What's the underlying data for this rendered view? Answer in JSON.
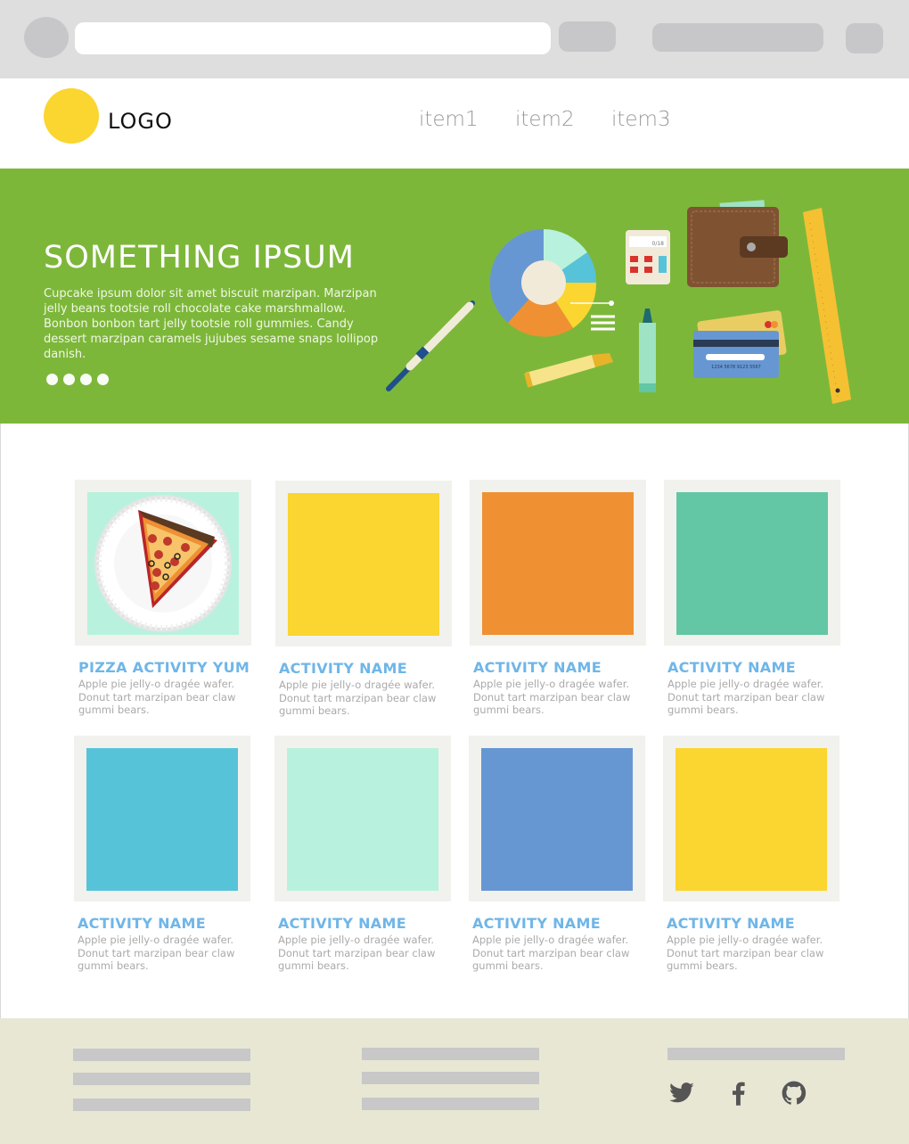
{
  "header": {
    "logo_text": "LOGO",
    "nav": [
      "item1",
      "item2",
      "item3"
    ],
    "logo_color": "#fbd530"
  },
  "hero": {
    "title": "SOMETHING IPSUM",
    "text": "Cupcake ipsum dolor sit amet biscuit marzipan. Marzipan jelly beans tootsie roll chocolate cake marshmallow. Bonbon bonbon tart jelly tootsie roll gummies. Candy dessert marzipan caramels jujubes sesame snaps lollipop danish.",
    "background": "#7db73a",
    "slide_count": 4,
    "calculator_display": "0/18",
    "card_number": "1234 5678 9123 5567"
  },
  "activities": [
    {
      "title": "PIZZA ACTIVITY YUM",
      "description": "Apple pie jelly-o dragée wafer. Donut tart marzipan bear claw gummi bears.",
      "color": "#b8f2de",
      "image": "pizza"
    },
    {
      "title": "ACTIVITY NAME",
      "description": "Apple pie jelly-o dragée wafer. Donut tart marzipan bear claw gummi bears.",
      "color": "#fbd530"
    },
    {
      "title": "ACTIVITY NAME",
      "description": "Apple pie jelly-o dragée wafer. Donut tart marzipan bear claw gummi bears.",
      "color": "#ef9132"
    },
    {
      "title": "ACTIVITY NAME",
      "description": "Apple pie jelly-o dragée wafer. Donut tart marzipan bear claw gummi bears.",
      "color": "#63c6a5"
    },
    {
      "title": "ACTIVITY NAME",
      "description": "Apple pie jelly-o dragée wafer. Donut tart marzipan bear claw gummi bears.",
      "color": "#57c3d8"
    },
    {
      "title": "ACTIVITY NAME",
      "description": "Apple pie jelly-o dragée wafer. Donut tart marzipan bear claw gummi bears.",
      "color": "#b8f2de"
    },
    {
      "title": "ACTIVITY NAME",
      "description": "Apple pie jelly-o dragée wafer. Donut tart marzipan bear claw gummi bears.",
      "color": "#6697d3"
    },
    {
      "title": "ACTIVITY NAME",
      "description": "Apple pie jelly-o dragée wafer. Donut tart marzipan bear claw gummi bears.",
      "color": "#fbd530"
    }
  ],
  "footer": {
    "social_icons": [
      "twitter-icon",
      "facebook-icon",
      "github-icon"
    ],
    "background": "#e8e7d4"
  }
}
